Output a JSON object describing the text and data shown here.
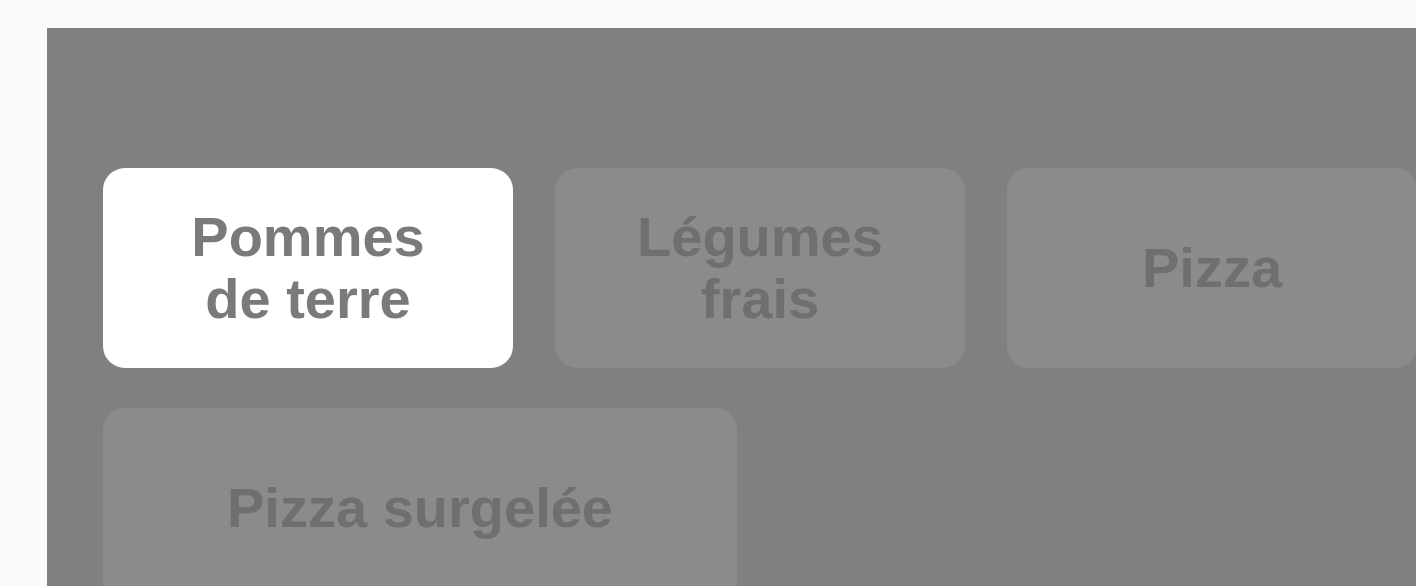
{
  "options": [
    {
      "label": "Pommes\nde terre",
      "selected": true
    },
    {
      "label": "Légumes\nfrais",
      "selected": false
    },
    {
      "label": "Pizza",
      "selected": false
    },
    {
      "label": "Pizza surgelée",
      "selected": false
    }
  ]
}
